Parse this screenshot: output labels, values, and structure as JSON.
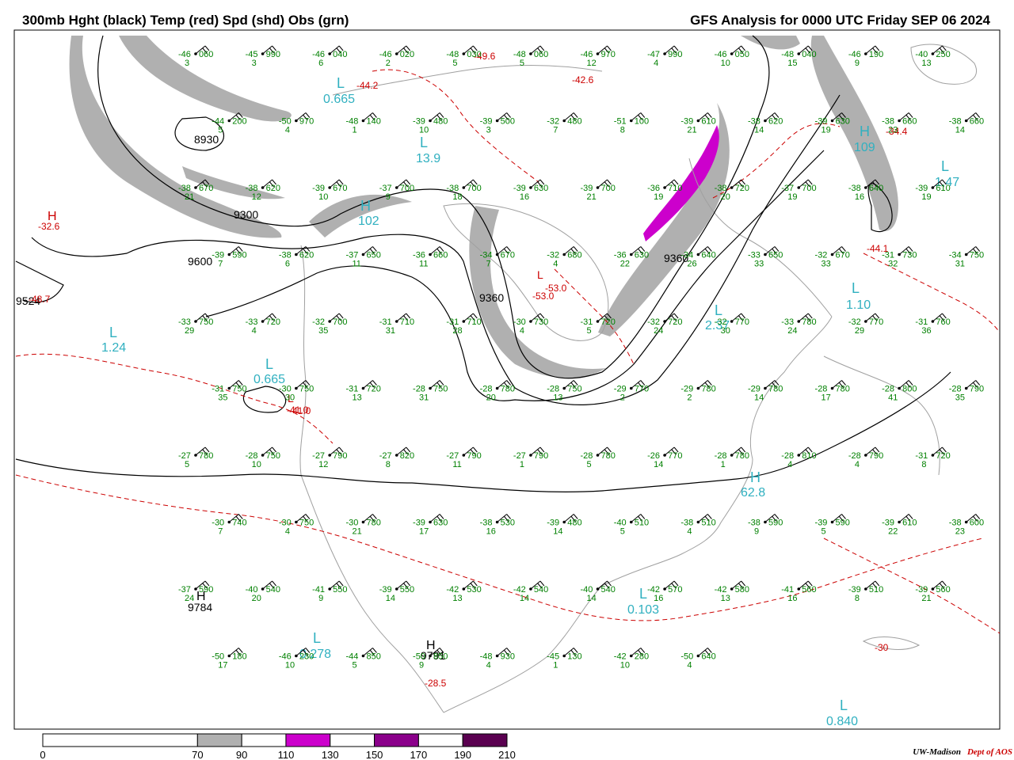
{
  "header": {
    "title_left": "300mb Hght (black) Temp (red) Spd (shd) Obs (grn)",
    "title_right": "GFS Analysis for 0000 UTC Friday  SEP 06 2024"
  },
  "colors": {
    "height_contour": "#000000",
    "temp_contour": "#cc0000",
    "obs": "#008000",
    "hl_labels": "#30b0c0",
    "speed_70_90": "#b0b0b0",
    "speed_110_130": "#cc00cc",
    "speed_150_170": "#8b008b",
    "speed_190_210": "#5a0050",
    "land": "#a0a0a0"
  },
  "colorbar": {
    "ticks": [
      "0",
      "70",
      "90",
      "110",
      "130",
      "150",
      "170",
      "190",
      "210"
    ],
    "bins": [
      {
        "from": 0,
        "to": 70,
        "color": "#ffffff"
      },
      {
        "from": 70,
        "to": 90,
        "color": "#b0b0b0"
      },
      {
        "from": 90,
        "to": 110,
        "color": "#ffffff"
      },
      {
        "from": 110,
        "to": 130,
        "color": "#cc00cc"
      },
      {
        "from": 130,
        "to": 150,
        "color": "#ffffff"
      },
      {
        "from": 150,
        "to": 170,
        "color": "#8b008b"
      },
      {
        "from": 170,
        "to": 190,
        "color": "#ffffff"
      },
      {
        "from": 190,
        "to": 210,
        "color": "#5a0050"
      }
    ]
  },
  "height_labels": [
    "8930",
    "9360",
    "9300",
    "9600",
    "9360",
    "9524",
    "9784",
    "9791"
  ],
  "centers": [
    {
      "type": "H",
      "value": "-32.6"
    },
    {
      "type": "L",
      "value": "0.665"
    },
    {
      "type": "L",
      "value": "1.24"
    },
    {
      "type": "L",
      "value": "0.665"
    },
    {
      "type": "H",
      "value": "102"
    },
    {
      "type": "L",
      "value": "13.9"
    },
    {
      "type": "H",
      "value": "62.8"
    },
    {
      "type": "L",
      "value": "0.103"
    },
    {
      "type": "L",
      "value": "0.278"
    },
    {
      "type": "H",
      "value": "9784"
    },
    {
      "type": "H",
      "value": "9791"
    },
    {
      "type": "L",
      "value": "0.840"
    },
    {
      "type": "L",
      "value": "1.47"
    },
    {
      "type": "L",
      "value": "1.10"
    },
    {
      "type": "H",
      "value": "109"
    },
    {
      "type": "L",
      "value": "2.37"
    },
    {
      "type": "L",
      "value": "-41.0"
    },
    {
      "type": "L",
      "value": "-53.0"
    }
  ],
  "temp_labels": [
    "-44.2",
    "-49.6",
    "-42.6",
    "-34.4",
    "-44.1",
    "-48.7",
    "-53.0",
    "-41.0",
    "-28.5",
    "-30"
  ],
  "observations": [
    {
      "t": "-46",
      "h": "060",
      "s": "3"
    },
    {
      "t": "-45",
      "h": "990",
      "s": "3"
    },
    {
      "t": "-46",
      "h": "040",
      "s": "6"
    },
    {
      "t": "-46",
      "h": "020",
      "s": "2"
    },
    {
      "t": "-48",
      "h": "030",
      "s": "5"
    },
    {
      "t": "-48",
      "h": "060",
      "s": "5"
    },
    {
      "t": "-46",
      "h": "970",
      "s": "12"
    },
    {
      "t": "-47",
      "h": "990",
      "s": "4"
    },
    {
      "t": "-46",
      "h": "050",
      "s": "10"
    },
    {
      "t": "-48",
      "h": "040",
      "s": "15"
    },
    {
      "t": "-46",
      "h": "190",
      "s": "9"
    },
    {
      "t": "-40",
      "h": "250",
      "s": "13"
    },
    {
      "t": "-44",
      "h": "200",
      "s": "5"
    },
    {
      "t": "-50",
      "h": "970",
      "s": "4"
    },
    {
      "t": "-48",
      "h": "140",
      "s": "1"
    },
    {
      "t": "-39",
      "h": "480",
      "s": "10"
    },
    {
      "t": "-39",
      "h": "500",
      "s": "3"
    },
    {
      "t": "-32",
      "h": "480",
      "s": "7"
    },
    {
      "t": "-51",
      "h": "100",
      "s": "8"
    },
    {
      "t": "-39",
      "h": "610",
      "s": "21"
    },
    {
      "t": "-38",
      "h": "620",
      "s": "14"
    },
    {
      "t": "-39",
      "h": "630",
      "s": "19"
    },
    {
      "t": "-38",
      "h": "660",
      "s": "23"
    },
    {
      "t": "-38",
      "h": "660",
      "s": "14"
    },
    {
      "t": "-38",
      "h": "670",
      "s": "21"
    },
    {
      "t": "-38",
      "h": "620",
      "s": "12"
    },
    {
      "t": "-39",
      "h": "670",
      "s": "10"
    },
    {
      "t": "-37",
      "h": "700",
      "s": "9"
    },
    {
      "t": "-38",
      "h": "700",
      "s": "18"
    },
    {
      "t": "-39",
      "h": "630",
      "s": "16"
    },
    {
      "t": "-39",
      "h": "700",
      "s": "21"
    },
    {
      "t": "-36",
      "h": "710",
      "s": "19"
    },
    {
      "t": "-38",
      "h": "720",
      "s": "20"
    },
    {
      "t": "-37",
      "h": "700",
      "s": "19"
    },
    {
      "t": "-38",
      "h": "640",
      "s": "16"
    },
    {
      "t": "-39",
      "h": "610",
      "s": "19"
    },
    {
      "t": "-39",
      "h": "590",
      "s": "7"
    },
    {
      "t": "-38",
      "h": "620",
      "s": "6"
    },
    {
      "t": "-37",
      "h": "650",
      "s": "11"
    },
    {
      "t": "-36",
      "h": "660",
      "s": "11"
    },
    {
      "t": "-34",
      "h": "670",
      "s": "7"
    },
    {
      "t": "-32",
      "h": "680",
      "s": "4"
    },
    {
      "t": "-36",
      "h": "630",
      "s": "22"
    },
    {
      "t": "-34",
      "h": "640",
      "s": "26"
    },
    {
      "t": "-33",
      "h": "650",
      "s": "33"
    },
    {
      "t": "-32",
      "h": "670",
      "s": "33"
    },
    {
      "t": "-31",
      "h": "730",
      "s": "32"
    },
    {
      "t": "-34",
      "h": "750",
      "s": "31"
    },
    {
      "t": "-33",
      "h": "750",
      "s": "29"
    },
    {
      "t": "-33",
      "h": "720",
      "s": "4"
    },
    {
      "t": "-32",
      "h": "700",
      "s": "35"
    },
    {
      "t": "-31",
      "h": "710",
      "s": "31"
    },
    {
      "t": "-31",
      "h": "710",
      "s": "28"
    },
    {
      "t": "-30",
      "h": "730",
      "s": "4"
    },
    {
      "t": "-31",
      "h": "720",
      "s": "5"
    },
    {
      "t": "-32",
      "h": "720",
      "s": "24"
    },
    {
      "t": "-32",
      "h": "770",
      "s": "30"
    },
    {
      "t": "-33",
      "h": "780",
      "s": "24"
    },
    {
      "t": "-32",
      "h": "770",
      "s": "29"
    },
    {
      "t": "-31",
      "h": "760",
      "s": "36"
    },
    {
      "t": "-31",
      "h": "750",
      "s": "35"
    },
    {
      "t": "-30",
      "h": "750",
      "s": "30"
    },
    {
      "t": "-31",
      "h": "720",
      "s": "13"
    },
    {
      "t": "-28",
      "h": "750",
      "s": "31"
    },
    {
      "t": "-28",
      "h": "780",
      "s": "20"
    },
    {
      "t": "-28",
      "h": "750",
      "s": "13"
    },
    {
      "t": "-29",
      "h": "770",
      "s": "2"
    },
    {
      "t": "-29",
      "h": "780",
      "s": "2"
    },
    {
      "t": "-29",
      "h": "780",
      "s": "14"
    },
    {
      "t": "-28",
      "h": "780",
      "s": "17"
    },
    {
      "t": "-28",
      "h": "800",
      "s": "41"
    },
    {
      "t": "-28",
      "h": "790",
      "s": "35"
    },
    {
      "t": "-27",
      "h": "780",
      "s": "5"
    },
    {
      "t": "-28",
      "h": "750",
      "s": "10"
    },
    {
      "t": "-27",
      "h": "790",
      "s": "12"
    },
    {
      "t": "-27",
      "h": "820",
      "s": "8"
    },
    {
      "t": "-27",
      "h": "790",
      "s": "11"
    },
    {
      "t": "-27",
      "h": "790",
      "s": "1"
    },
    {
      "t": "-28",
      "h": "780",
      "s": "5"
    },
    {
      "t": "-26",
      "h": "770",
      "s": "14"
    },
    {
      "t": "-28",
      "h": "780",
      "s": "1"
    },
    {
      "t": "-28",
      "h": "810",
      "s": "4"
    },
    {
      "t": "-28",
      "h": "790",
      "s": "4"
    },
    {
      "t": "-31",
      "h": "720",
      "s": "8"
    },
    {
      "t": "-30",
      "h": "740",
      "s": "7"
    },
    {
      "t": "-30",
      "h": "750",
      "s": "4"
    },
    {
      "t": "-30",
      "h": "780",
      "s": "21"
    },
    {
      "t": "-39",
      "h": "630",
      "s": "17"
    },
    {
      "t": "-38",
      "h": "530",
      "s": "16"
    },
    {
      "t": "-39",
      "h": "480",
      "s": "14"
    },
    {
      "t": "-40",
      "h": "510",
      "s": "5"
    },
    {
      "t": "-38",
      "h": "510",
      "s": "4"
    },
    {
      "t": "-38",
      "h": "590",
      "s": "9"
    },
    {
      "t": "-39",
      "h": "590",
      "s": "5"
    },
    {
      "t": "-39",
      "h": "610",
      "s": "22"
    },
    {
      "t": "-38",
      "h": "600",
      "s": "23"
    },
    {
      "t": "-37",
      "h": "590",
      "s": "24"
    },
    {
      "t": "-40",
      "h": "540",
      "s": "20"
    },
    {
      "t": "-41",
      "h": "550",
      "s": "9"
    },
    {
      "t": "-39",
      "h": "550",
      "s": "14"
    },
    {
      "t": "-42",
      "h": "530",
      "s": "13"
    },
    {
      "t": "-42",
      "h": "540",
      "s": "14"
    },
    {
      "t": "-40",
      "h": "540",
      "s": "14"
    },
    {
      "t": "-42",
      "h": "570",
      "s": "16"
    },
    {
      "t": "-42",
      "h": "580",
      "s": "13"
    },
    {
      "t": "-41",
      "h": "560",
      "s": "16"
    },
    {
      "t": "-39",
      "h": "510",
      "s": "8"
    },
    {
      "t": "-39",
      "h": "560",
      "s": "21"
    },
    {
      "t": "-50",
      "h": "180",
      "s": "17"
    },
    {
      "t": "-46",
      "h": "230",
      "s": "10"
    },
    {
      "t": "-44",
      "h": "850",
      "s": "5"
    },
    {
      "t": "-50",
      "h": "850",
      "s": "9"
    },
    {
      "t": "-48",
      "h": "930",
      "s": "4"
    },
    {
      "t": "-45",
      "h": "130",
      "s": "1"
    },
    {
      "t": "-42",
      "h": "280",
      "s": "10"
    },
    {
      "t": "-50",
      "h": "640",
      "s": "4"
    }
  ],
  "credit": {
    "org": "UW-Madison",
    "dept": "Dept of AOS"
  }
}
